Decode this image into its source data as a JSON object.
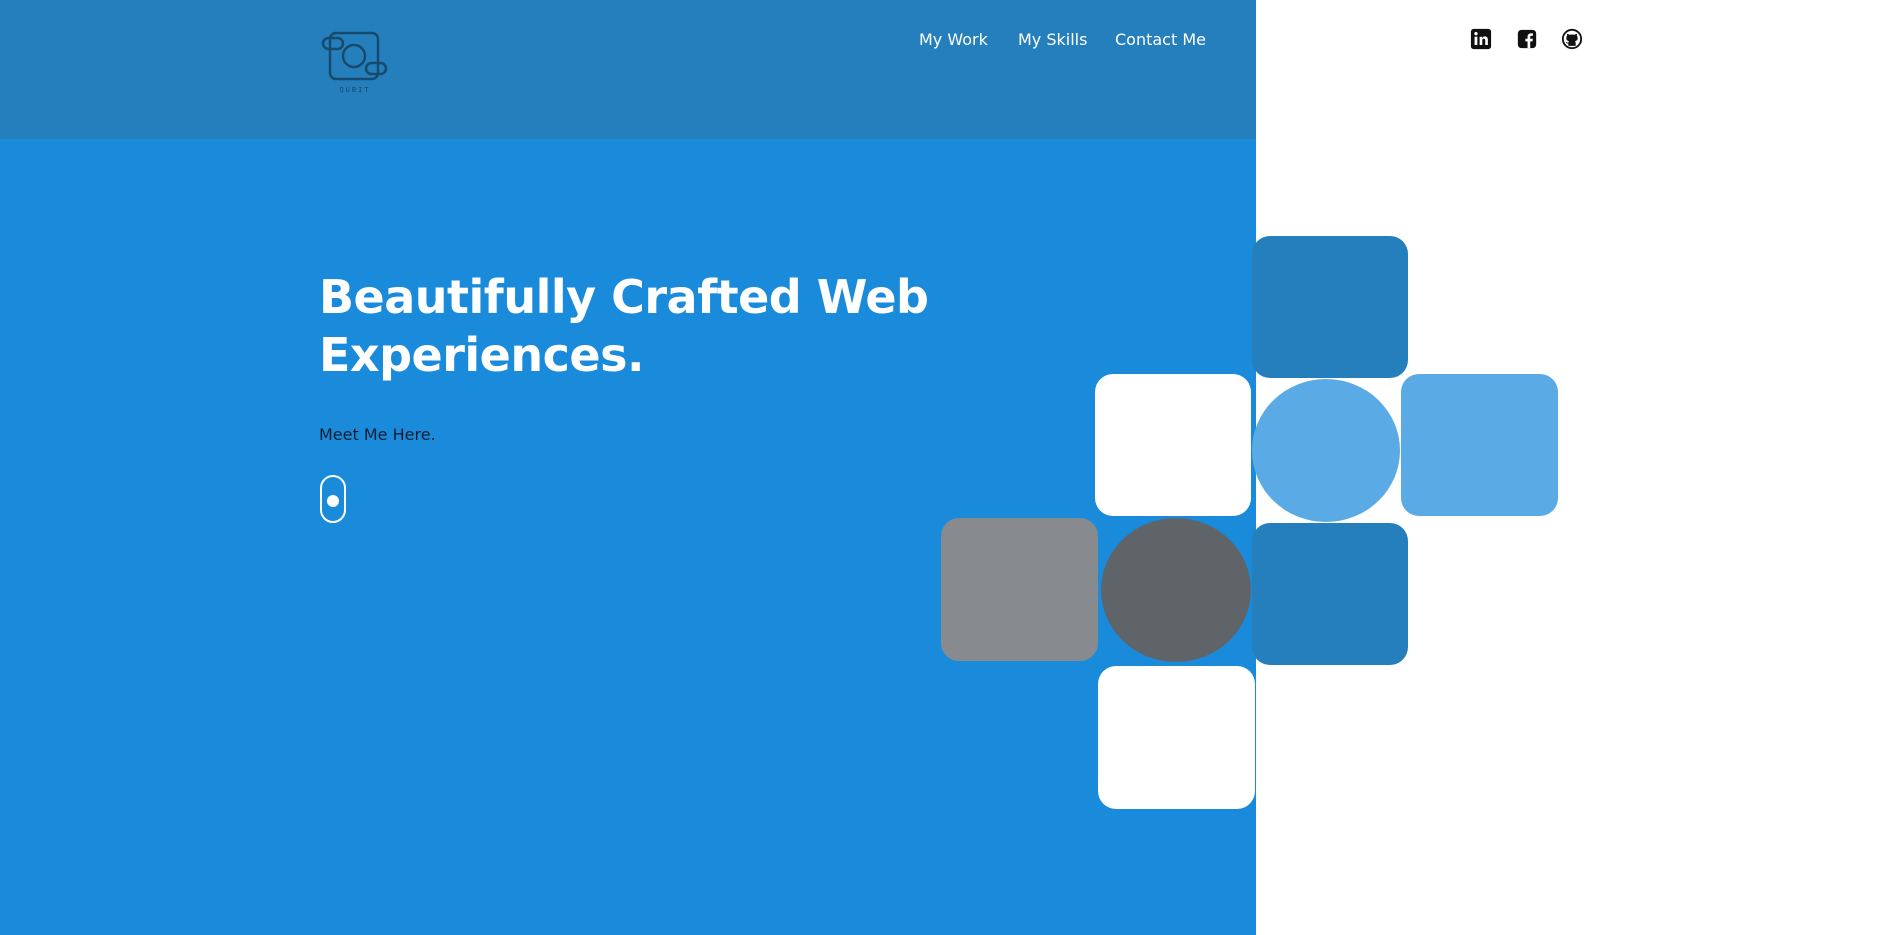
{
  "logo": {
    "text": "QUBIT",
    "icon": "qubit-logo-icon"
  },
  "nav": {
    "items": [
      {
        "label": "My Work"
      },
      {
        "label": "My Skills"
      },
      {
        "label": "Contact Me"
      }
    ]
  },
  "social": [
    {
      "name": "LinkedIn",
      "icon": "linkedin-icon"
    },
    {
      "name": "Facebook",
      "icon": "facebook-icon"
    },
    {
      "name": "GitHub",
      "icon": "github-icon"
    }
  ],
  "hero": {
    "headline_line1": "Beautifully Crafted Web",
    "headline_line2": "Experiences.",
    "tagline": "Meet Me Here.",
    "scroll_icon": "mouse-scroll-icon"
  },
  "colors": {
    "header_bg": "#247fbc",
    "panel_bg": "#1a8bdb",
    "page_bg": "#ffffff",
    "tile_dark_blue": "#247fbc",
    "tile_light_blue": "#5aabe5",
    "tile_gray": "#878b8f",
    "tile_dark_gray": "#5f6469",
    "tile_white": "#ffffff"
  }
}
